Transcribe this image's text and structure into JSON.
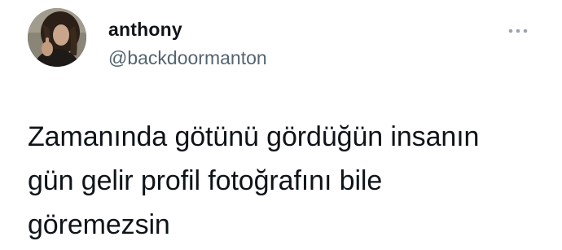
{
  "author": {
    "display_name": "anthony",
    "handle": "@backdoormanton",
    "avatar_icon": "profile-photo"
  },
  "more_icon": "more-horizontal-icon",
  "tweet": {
    "lines": [
      "Zamanında götünü gördüğün insanın",
      "gün gelir profil fotoğrafını bile",
      "göremezsin"
    ]
  },
  "colors": {
    "text": "#0f1419",
    "secondary": "#536471",
    "background": "#ffffff"
  }
}
